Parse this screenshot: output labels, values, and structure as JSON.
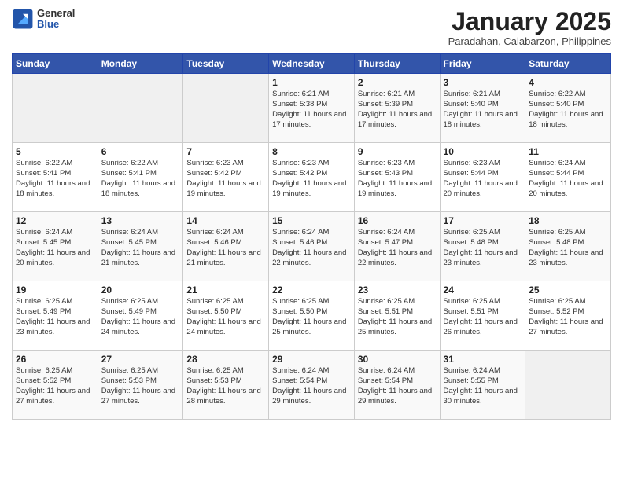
{
  "header": {
    "logo": {
      "general": "General",
      "blue": "Blue"
    },
    "title": "January 2025",
    "location": "Paradahan, Calabarzon, Philippines"
  },
  "weekdays": [
    "Sunday",
    "Monday",
    "Tuesday",
    "Wednesday",
    "Thursday",
    "Friday",
    "Saturday"
  ],
  "weeks": [
    [
      {
        "day": "",
        "info": ""
      },
      {
        "day": "",
        "info": ""
      },
      {
        "day": "",
        "info": ""
      },
      {
        "day": "1",
        "info": "Sunrise: 6:21 AM\nSunset: 5:38 PM\nDaylight: 11 hours and 17 minutes."
      },
      {
        "day": "2",
        "info": "Sunrise: 6:21 AM\nSunset: 5:39 PM\nDaylight: 11 hours and 17 minutes."
      },
      {
        "day": "3",
        "info": "Sunrise: 6:21 AM\nSunset: 5:40 PM\nDaylight: 11 hours and 18 minutes."
      },
      {
        "day": "4",
        "info": "Sunrise: 6:22 AM\nSunset: 5:40 PM\nDaylight: 11 hours and 18 minutes."
      }
    ],
    [
      {
        "day": "5",
        "info": "Sunrise: 6:22 AM\nSunset: 5:41 PM\nDaylight: 11 hours and 18 minutes."
      },
      {
        "day": "6",
        "info": "Sunrise: 6:22 AM\nSunset: 5:41 PM\nDaylight: 11 hours and 18 minutes."
      },
      {
        "day": "7",
        "info": "Sunrise: 6:23 AM\nSunset: 5:42 PM\nDaylight: 11 hours and 19 minutes."
      },
      {
        "day": "8",
        "info": "Sunrise: 6:23 AM\nSunset: 5:42 PM\nDaylight: 11 hours and 19 minutes."
      },
      {
        "day": "9",
        "info": "Sunrise: 6:23 AM\nSunset: 5:43 PM\nDaylight: 11 hours and 19 minutes."
      },
      {
        "day": "10",
        "info": "Sunrise: 6:23 AM\nSunset: 5:44 PM\nDaylight: 11 hours and 20 minutes."
      },
      {
        "day": "11",
        "info": "Sunrise: 6:24 AM\nSunset: 5:44 PM\nDaylight: 11 hours and 20 minutes."
      }
    ],
    [
      {
        "day": "12",
        "info": "Sunrise: 6:24 AM\nSunset: 5:45 PM\nDaylight: 11 hours and 20 minutes."
      },
      {
        "day": "13",
        "info": "Sunrise: 6:24 AM\nSunset: 5:45 PM\nDaylight: 11 hours and 21 minutes."
      },
      {
        "day": "14",
        "info": "Sunrise: 6:24 AM\nSunset: 5:46 PM\nDaylight: 11 hours and 21 minutes."
      },
      {
        "day": "15",
        "info": "Sunrise: 6:24 AM\nSunset: 5:46 PM\nDaylight: 11 hours and 22 minutes."
      },
      {
        "day": "16",
        "info": "Sunrise: 6:24 AM\nSunset: 5:47 PM\nDaylight: 11 hours and 22 minutes."
      },
      {
        "day": "17",
        "info": "Sunrise: 6:25 AM\nSunset: 5:48 PM\nDaylight: 11 hours and 23 minutes."
      },
      {
        "day": "18",
        "info": "Sunrise: 6:25 AM\nSunset: 5:48 PM\nDaylight: 11 hours and 23 minutes."
      }
    ],
    [
      {
        "day": "19",
        "info": "Sunrise: 6:25 AM\nSunset: 5:49 PM\nDaylight: 11 hours and 23 minutes."
      },
      {
        "day": "20",
        "info": "Sunrise: 6:25 AM\nSunset: 5:49 PM\nDaylight: 11 hours and 24 minutes."
      },
      {
        "day": "21",
        "info": "Sunrise: 6:25 AM\nSunset: 5:50 PM\nDaylight: 11 hours and 24 minutes."
      },
      {
        "day": "22",
        "info": "Sunrise: 6:25 AM\nSunset: 5:50 PM\nDaylight: 11 hours and 25 minutes."
      },
      {
        "day": "23",
        "info": "Sunrise: 6:25 AM\nSunset: 5:51 PM\nDaylight: 11 hours and 25 minutes."
      },
      {
        "day": "24",
        "info": "Sunrise: 6:25 AM\nSunset: 5:51 PM\nDaylight: 11 hours and 26 minutes."
      },
      {
        "day": "25",
        "info": "Sunrise: 6:25 AM\nSunset: 5:52 PM\nDaylight: 11 hours and 27 minutes."
      }
    ],
    [
      {
        "day": "26",
        "info": "Sunrise: 6:25 AM\nSunset: 5:52 PM\nDaylight: 11 hours and 27 minutes."
      },
      {
        "day": "27",
        "info": "Sunrise: 6:25 AM\nSunset: 5:53 PM\nDaylight: 11 hours and 27 minutes."
      },
      {
        "day": "28",
        "info": "Sunrise: 6:25 AM\nSunset: 5:53 PM\nDaylight: 11 hours and 28 minutes."
      },
      {
        "day": "29",
        "info": "Sunrise: 6:24 AM\nSunset: 5:54 PM\nDaylight: 11 hours and 29 minutes."
      },
      {
        "day": "30",
        "info": "Sunrise: 6:24 AM\nSunset: 5:54 PM\nDaylight: 11 hours and 29 minutes."
      },
      {
        "day": "31",
        "info": "Sunrise: 6:24 AM\nSunset: 5:55 PM\nDaylight: 11 hours and 30 minutes."
      },
      {
        "day": "",
        "info": ""
      }
    ]
  ]
}
